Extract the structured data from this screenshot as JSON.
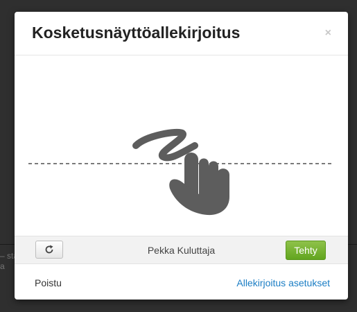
{
  "backdrop": {
    "line1": "– sta",
    "line2": "a"
  },
  "modal": {
    "title": "Kosketusnäyttöallekirjoitus",
    "close_glyph": "×"
  },
  "signature_pad": {
    "illustration_icon": "hand-drawing-signature-icon"
  },
  "toolbar": {
    "reset_icon": "refresh-icon",
    "signer_name": "Pekka Kuluttaja",
    "done_label": "Tehty"
  },
  "footer": {
    "exit_label": "Poistu",
    "settings_label": "Allekirjoitus asetukset"
  },
  "colors": {
    "overlay": "#2f2f2f",
    "done_green": "#6fb12c",
    "link_blue": "#1a7dc4",
    "hand_gray": "#5d5d5d"
  }
}
